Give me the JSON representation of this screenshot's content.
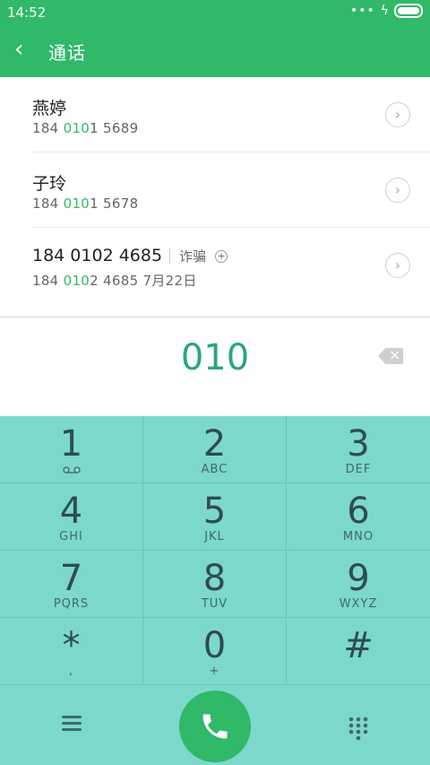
{
  "status": {
    "time": "14:52",
    "dots": "•••",
    "bolt": "ϟ"
  },
  "header": {
    "back": "‹",
    "title": "通话"
  },
  "contacts": [
    {
      "name": "燕婷",
      "num_pre": "184 ",
      "num_match": "010",
      "num_post": "1 5689"
    },
    {
      "name": "子玲",
      "num_pre": "184 ",
      "num_match": "010",
      "num_post": "1 5678"
    },
    {
      "name": "184 0102 4685",
      "tag": "诈骗",
      "num_pre": "184 ",
      "num_match": "010",
      "num_post": "2 4685  7月22日"
    }
  ],
  "dialer": {
    "input": "010"
  },
  "keys": [
    {
      "digit": "1",
      "letters": ""
    },
    {
      "digit": "2",
      "letters": "ABC"
    },
    {
      "digit": "3",
      "letters": "DEF"
    },
    {
      "digit": "4",
      "letters": "GHI"
    },
    {
      "digit": "5",
      "letters": "JKL"
    },
    {
      "digit": "6",
      "letters": "MNO"
    },
    {
      "digit": "7",
      "letters": "PQRS"
    },
    {
      "digit": "8",
      "letters": "TUV"
    },
    {
      "digit": "9",
      "letters": "WXYZ"
    },
    {
      "digit": "*",
      "letters": ","
    },
    {
      "digit": "0",
      "letters": "+"
    },
    {
      "digit": "#",
      "letters": ""
    }
  ],
  "colors": {
    "accent": "#2fb968",
    "keypad_bg": "#7dd8cc",
    "dial_text": "#2aa878"
  },
  "icons": {
    "voicemail": "voicemail-icon",
    "menu": "menu-icon",
    "call": "phone-icon",
    "grid": "dialpad-icon",
    "backspace": "backspace-icon",
    "chevron": "chevron-right-icon"
  }
}
